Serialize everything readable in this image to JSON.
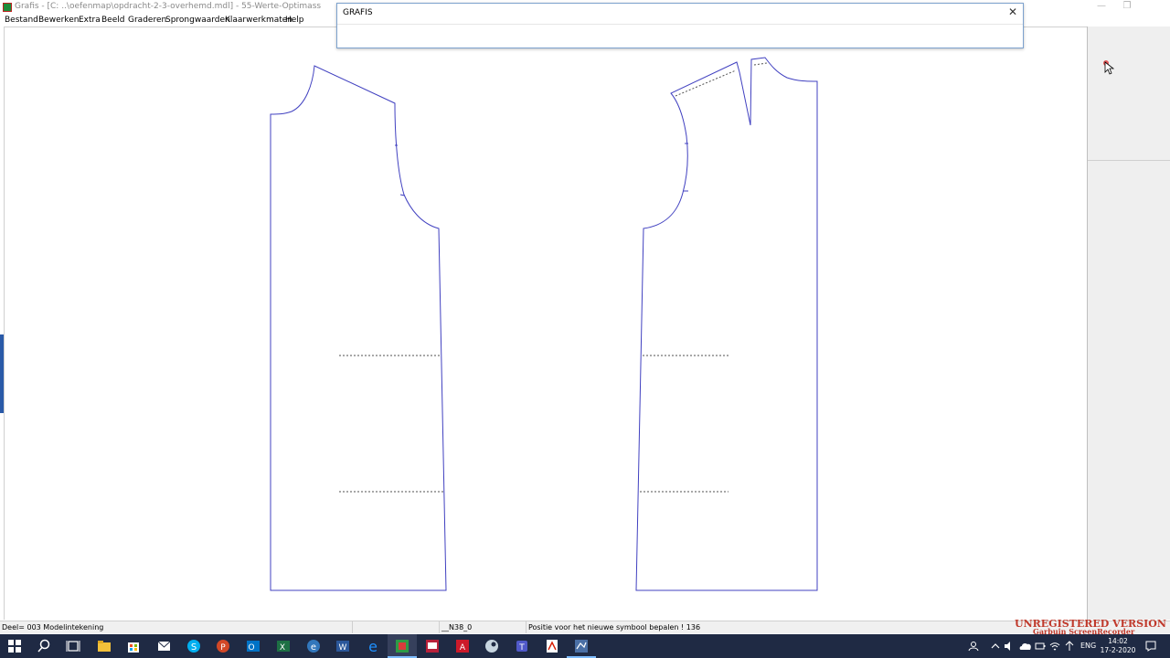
{
  "window": {
    "title": "Grafis - [C: ..\\oefenmap\\opdracht-2-3-overhemd.mdl] - 55-Werte-Optimass",
    "minimize_glyph": "—",
    "maximize_glyph": "❐"
  },
  "menu": {
    "items": [
      "Bestand",
      "Bewerken",
      "Extra",
      "Beeld",
      "Graderen",
      "Sprongwaarden",
      "Klaarwerkmaten",
      "Help"
    ]
  },
  "dialog": {
    "title": "GRAFIS",
    "close_glyph": "✕"
  },
  "status": {
    "part": "Deel= 003  Modelintekening",
    "code": "__N38_0",
    "message": "Positie voor het nieuwe symbool bepalen ! 136"
  },
  "watermark": {
    "line1": "UNREGISTERED VERSION",
    "line2": "Garbuin ScreenRecorder"
  },
  "taskbar": {
    "language": "ENG",
    "time": "14:02",
    "date": "17-2-2020",
    "apps": [
      "start-icon",
      "search-icon",
      "task-view-icon",
      "file-explorer-icon",
      "store-icon",
      "mail-icon",
      "skype-icon",
      "powerpoint-icon",
      "outlook-icon",
      "excel-icon",
      "edge-icon",
      "word-icon",
      "ie-icon",
      "grafis-icon",
      "screen-recorder-icon",
      "adobe-icon",
      "steam-icon",
      "teams-icon",
      "acrobat-icon",
      "grafis-secondary-icon"
    ]
  },
  "colors": {
    "pattern_line": "#4040c0",
    "dotted_line": "#505050",
    "taskbar": "#1f2a44",
    "watermark": "#c0392b",
    "accent": "#2a5aa8"
  }
}
